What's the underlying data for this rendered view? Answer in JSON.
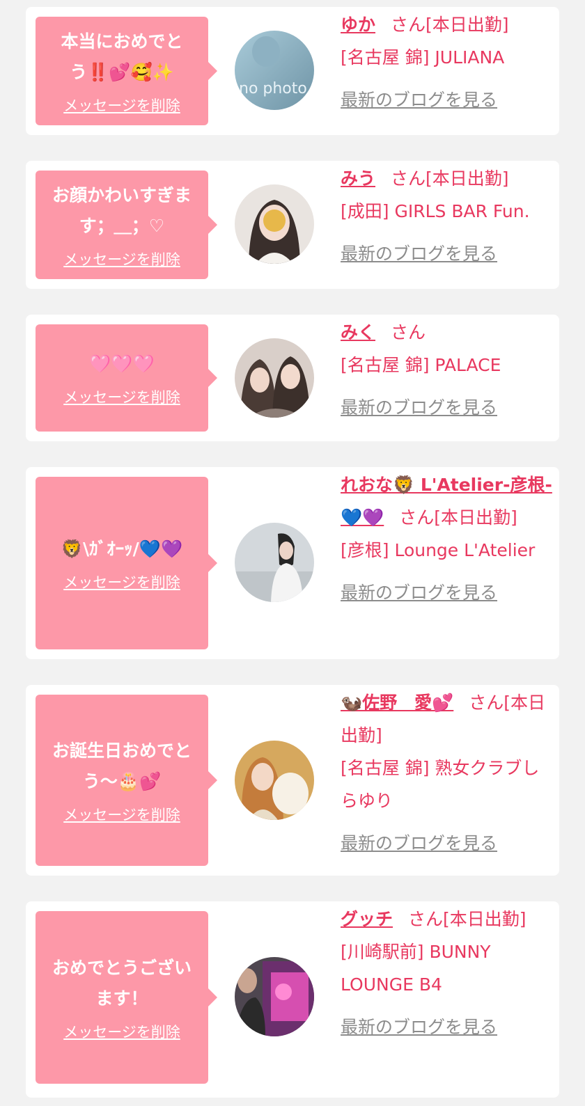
{
  "delete_label": "メッセージを削除",
  "blog_label": "最新のブログを見る",
  "san_label": "さん",
  "colors": {
    "background": "#f2f2f2",
    "bubble": "#fd98a8",
    "accent": "#e8385f",
    "link_gray": "#8c8c8c"
  },
  "cards": [
    {
      "message": "本当におめでとう‼️💕🥰✨",
      "name": "ゆか",
      "status": "[本日出勤]",
      "shop": "[名古屋 錦] JULIANA",
      "avatar_icon": "no-photo-avatar",
      "avatar_text": "no photo"
    },
    {
      "message": "お顔かわいすぎます；＿；♡",
      "name": "みう",
      "status": "[本日出勤]",
      "shop": "[成田] GIRLS BAR Fun.",
      "avatar_icon": "girl-photo-avatar"
    },
    {
      "message": "🩷🩷🩷",
      "name": "みく",
      "status": "",
      "shop": "[名古屋 錦] PALACE",
      "avatar_icon": "two-girls-photo-avatar"
    },
    {
      "message": "🦁\\ｶﾞｵｰｯ/💙💜",
      "name": "れおな🦁 L'Atelier-彦根-💙💜",
      "status": "[本日出勤]",
      "shop": "[彦根] Lounge L'Atelier",
      "avatar_icon": "girl-photo-avatar"
    },
    {
      "message": "お誕生日おめでとう〜🎂💕",
      "name": "🦦佐野　愛💕",
      "status": "[本日出勤]",
      "shop": "[名古屋 錦] 熟女クラブしらゆり",
      "avatar_icon": "girl-photo-avatar"
    },
    {
      "message": "おめでとうございます！",
      "name": "グッチ",
      "status": "[本日出勤]",
      "shop": "[川崎駅前] BUNNY LOUNGE B4",
      "avatar_icon": "selfie-photo-avatar"
    }
  ]
}
